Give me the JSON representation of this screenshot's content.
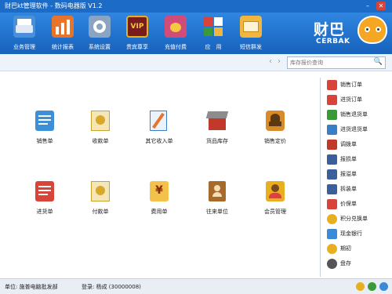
{
  "window": {
    "title": "财巴kt管理软件 - 数码电器版 V1.2",
    "minimize": "–",
    "close": "✕"
  },
  "toolbar": {
    "items": [
      {
        "label": "业务管理",
        "icon": "printer-icon",
        "color": "#4a90d9"
      },
      {
        "label": "统计报表",
        "icon": "chart-icon",
        "color": "#e8742c"
      },
      {
        "label": "系统设置",
        "icon": "gear-icon",
        "color": "#8aa4c4"
      },
      {
        "label": "贵宾尊享",
        "icon": "vip-icon",
        "color": "#7a1c1c"
      },
      {
        "label": "充值付费",
        "icon": "coins-icon",
        "color": "#d24c7a"
      },
      {
        "label": "应　用",
        "icon": "apps-icon",
        "color": "#3a9a3a"
      },
      {
        "label": "短信群发",
        "icon": "envelope-icon",
        "color": "#f1b63d"
      }
    ]
  },
  "logo": {
    "text": "财巴",
    "sub": "CERBAK"
  },
  "nav": {
    "back": "‹",
    "forward": "›",
    "search_placeholder": "库存报价查询",
    "search_icon": "🔍"
  },
  "main": {
    "items": [
      {
        "label": "销售单",
        "icon": "sales-order-icon",
        "color": "#3d8fd8"
      },
      {
        "label": "收款单",
        "icon": "receipt-icon",
        "color": "#d9a82a"
      },
      {
        "label": "其它收入单",
        "icon": "other-income-icon",
        "color": "#3a7ec8"
      },
      {
        "label": "货品库存",
        "icon": "inventory-icon",
        "color": "#c0392b"
      },
      {
        "label": "销售定价",
        "icon": "pricing-icon",
        "color": "#d98b2a"
      },
      {
        "label": "进货单",
        "icon": "purchase-order-icon",
        "color": "#d9443a"
      },
      {
        "label": "付款单",
        "icon": "payment-icon",
        "color": "#d9a82a"
      },
      {
        "label": "费用单",
        "icon": "expense-icon",
        "color": "#e0a020"
      },
      {
        "label": "往来单位",
        "icon": "contacts-icon",
        "color": "#a86a2a"
      },
      {
        "label": "会员管理",
        "icon": "member-icon",
        "color": "#e8b020"
      }
    ]
  },
  "right_panel": {
    "items": [
      {
        "label": "销售订单",
        "icon": "sales-order-small-icon",
        "color": "#d9443a"
      },
      {
        "label": "进货订单",
        "icon": "purchase-order-small-icon",
        "color": "#d9443a"
      },
      {
        "label": "销售退货单",
        "icon": "sales-return-icon",
        "color": "#3a9a3a"
      },
      {
        "label": "进货退货单",
        "icon": "purchase-return-icon",
        "color": "#3a7ec8"
      },
      {
        "label": "调拨单",
        "icon": "transfer-icon",
        "color": "#c0392b"
      },
      {
        "label": "报损单",
        "icon": "loss-report-icon",
        "color": "#3a5f9a"
      },
      {
        "label": "报溢单",
        "icon": "overflow-report-icon",
        "color": "#3a5f9a"
      },
      {
        "label": "拆装单",
        "icon": "assembly-icon",
        "color": "#3a5f9a"
      },
      {
        "label": "价保单",
        "icon": "price-protect-icon",
        "color": "#d9443a"
      },
      {
        "label": "积分兑换单",
        "icon": "points-icon",
        "color": "#e8b020"
      },
      {
        "label": "现金银行",
        "icon": "cash-bank-icon",
        "color": "#3a8ad8"
      },
      {
        "label": "期初",
        "icon": "opening-icon",
        "color": "#e8b020"
      },
      {
        "label": "盘存",
        "icon": "stocktake-icon",
        "color": "#555555"
      }
    ]
  },
  "status": {
    "unit": "单位: 施普电脑批发部",
    "login": "登录: 杨成 (30000008)"
  }
}
